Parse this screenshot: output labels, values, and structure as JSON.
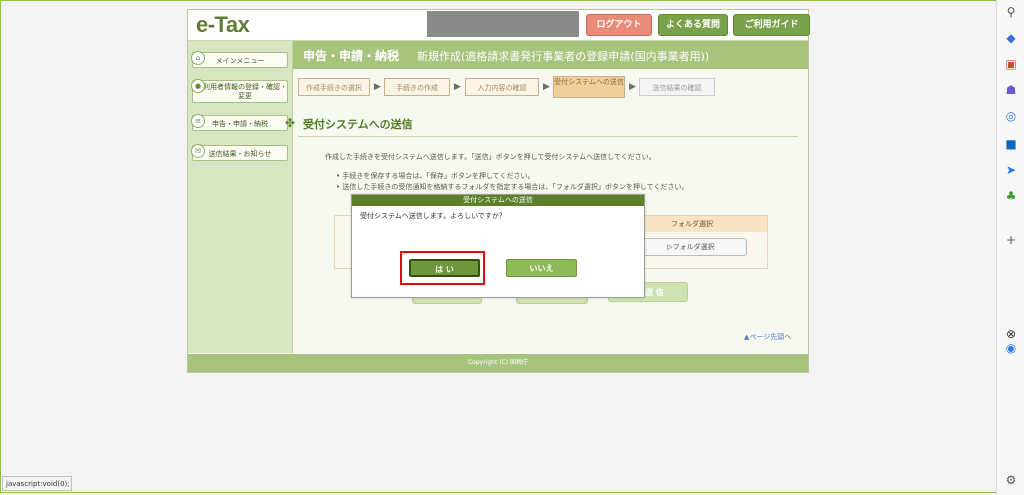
{
  "header": {
    "logo": "e-Tax",
    "logout_label": "ログアウト",
    "faq_label": "よくある質問",
    "guide_label": "ご利用ガイド"
  },
  "sidebar": {
    "items": [
      {
        "label": "メインメニュー"
      },
      {
        "label": "利用者情報の登録・確認・変更"
      },
      {
        "label": "申告・申請・納税"
      },
      {
        "label": "送信結果・お知らせ"
      }
    ]
  },
  "main": {
    "title": "申告・申請・納税",
    "subtitle": "新規作成(適格請求書発行事業者の登録申請(国内事業者用))",
    "steps": [
      "作成手続きの選択",
      "手続きの作成",
      "入力内容の確認",
      "受付システムへの送信",
      "送信結果の確認"
    ],
    "section_title": "受付システムへの送信",
    "instruction": "作成した手続きを受付システムへ送信します。「送信」ボタンを押して受付システムへ送信してください。",
    "bullet1": "手続きを保存する場合は、「保存」ボタンを押してください。",
    "bullet2": "送信した手続きの受信通知を格納するフォルダを指定する場合は、「フォルダ選択」ボタンを押してください。",
    "folder_header": "フォルダ選択",
    "folder_button": "フォルダ選択",
    "send_label": "送 信",
    "back_to_top": "ページ先頭へ",
    "copyright": "Copyright (C) 国税庁"
  },
  "dialog": {
    "title": "受付システムへの送信",
    "message": "受付システムへ送信します。よろしいですか？",
    "yes_label": "は い",
    "no_label": "いいえ"
  },
  "status_bar": "javascript:void(0);",
  "colors": {
    "primary_green": "#a7c47d",
    "dark_green": "#5b7f2b",
    "highlight_red": "#e60012"
  }
}
